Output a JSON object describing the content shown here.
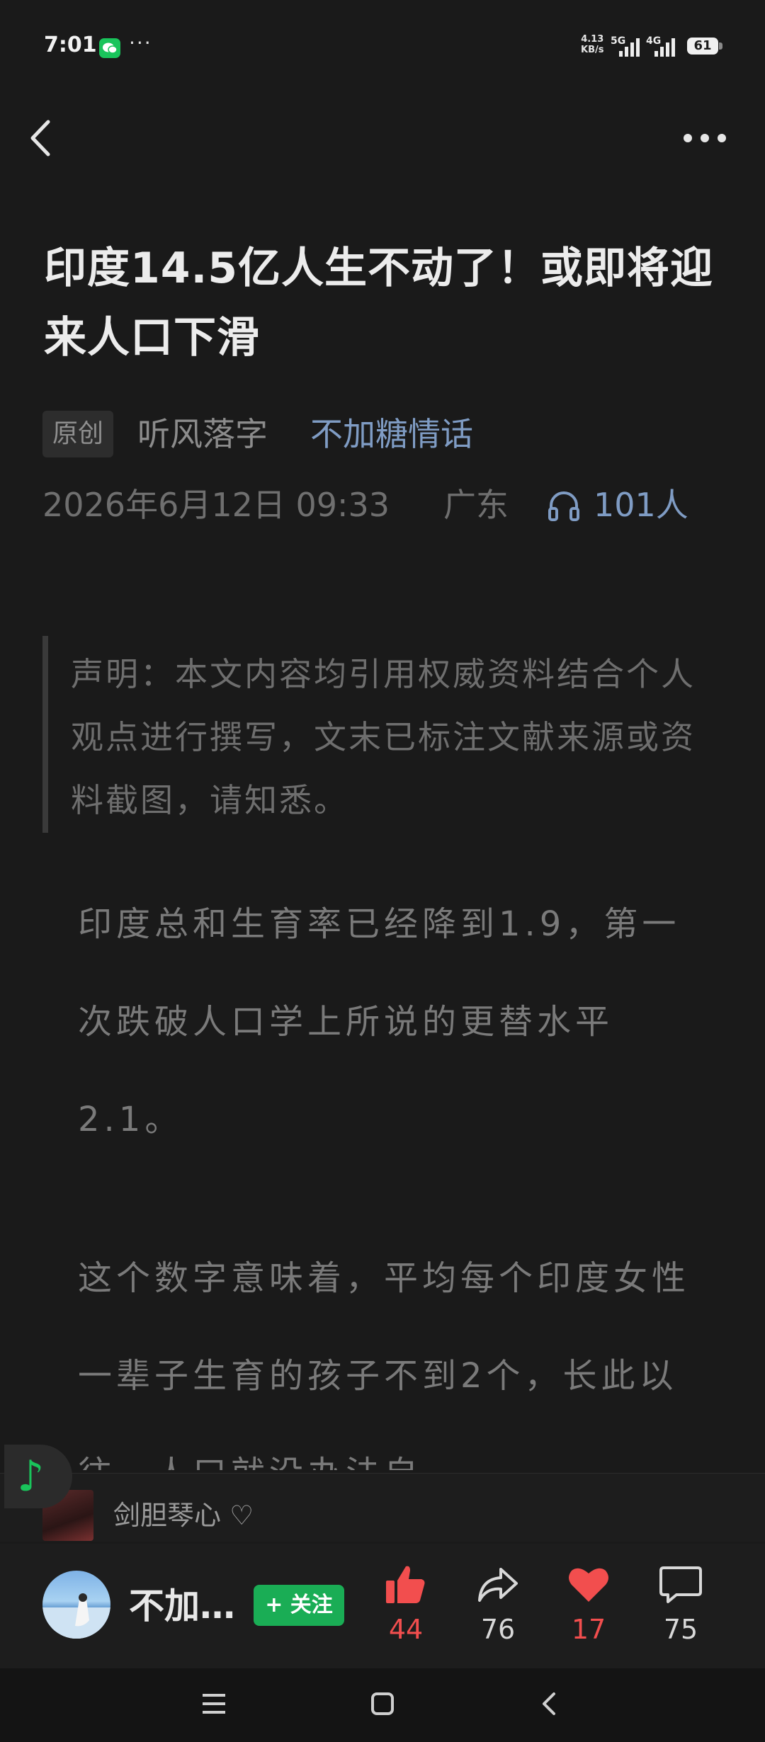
{
  "status_bar": {
    "time": "7:01",
    "overflow": "···",
    "net_speed_value": "4.13",
    "net_speed_unit": "KB/s",
    "signal_1": "5G",
    "signal_2": "4G",
    "battery": "61",
    "icons": [
      "wechat-notification-icon",
      "signal-icon",
      "battery-icon"
    ]
  },
  "nav": {
    "back_icon": "chevron-left-icon",
    "more_icon": "more-horizontal-icon"
  },
  "article": {
    "title": "印度14.5亿人生不动了！或即将迎来人口下滑",
    "original_tag": "原创",
    "author": "听风落字",
    "account": "不加糖情话",
    "date": "2026年6月12日 09:33",
    "location": "广东",
    "listeners": "101人",
    "disclaimer": "声明：本文内容均引用权威资料结合个人观点进行撰写，文末已标注文献来源或资料截图，请知悉。",
    "paragraphs": [
      "印度总和生育率已经降到1.9，第一次跌破人口学上所说的更替水平2.1。",
      "这个数字意味着，平均每个印度女性一辈子生育的孩子不到2个，长此以往，人口就没办法自"
    ]
  },
  "related": {
    "title": "剑胆琴心 ♡"
  },
  "action_bar": {
    "author_short": "不加…",
    "follow_label": "+ 关注",
    "like_count": "44",
    "share_count": "76",
    "favorite_count": "17",
    "comment_count": "75",
    "colors": {
      "like": "#f24e4e",
      "follow": "#1aad55",
      "link": "#7f9cc4"
    }
  },
  "system_nav": {
    "icons": [
      "menu-icon",
      "home-icon",
      "back-icon"
    ]
  }
}
